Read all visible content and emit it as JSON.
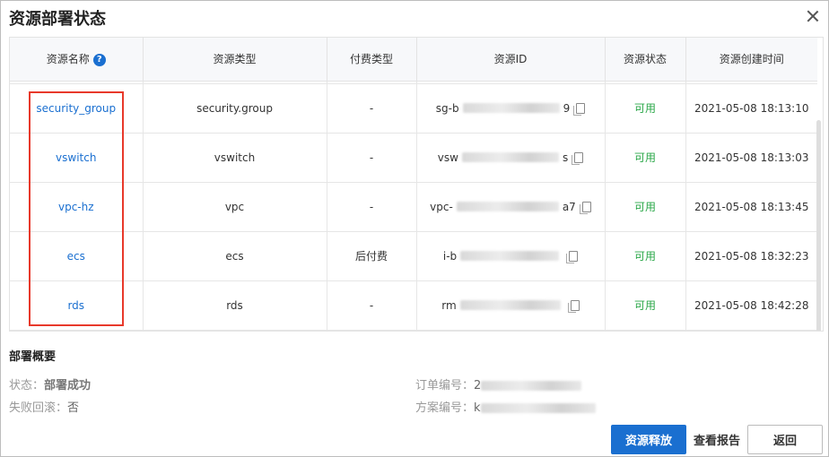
{
  "dialog": {
    "title": "资源部署状态"
  },
  "table": {
    "headers": [
      "资源名称",
      "资源类型",
      "付费类型",
      "资源ID",
      "资源状态",
      "资源创建时间"
    ],
    "rows": [
      {
        "name": "security_group",
        "type": "security.group",
        "pay": "-",
        "id_prefix": "sg-b",
        "id_suffix": "9",
        "status": "可用",
        "time": "2021-05-08 18:13:10"
      },
      {
        "name": "vswitch",
        "type": "vswitch",
        "pay": "-",
        "id_prefix": "vsw",
        "id_suffix": "s",
        "status": "可用",
        "time": "2021-05-08 18:13:03"
      },
      {
        "name": "vpc-hz",
        "type": "vpc",
        "pay": "-",
        "id_prefix": "vpc-",
        "id_suffix": "a7",
        "status": "可用",
        "time": "2021-05-08 18:13:45"
      },
      {
        "name": "ecs",
        "type": "ecs",
        "pay": "后付费",
        "id_prefix": "i-b",
        "id_suffix": "",
        "status": "可用",
        "time": "2021-05-08 18:32:23"
      },
      {
        "name": "rds",
        "type": "rds",
        "pay": "-",
        "id_prefix": "rm",
        "id_suffix": "",
        "status": "可用",
        "time": "2021-05-08 18:42:28"
      }
    ]
  },
  "summary": {
    "title": "部署概要",
    "status_label": "状态：",
    "status_value": "部署成功",
    "rollback_label": "失败回滚：",
    "rollback_value": "否",
    "order_label": "订单编号：",
    "order_value_prefix": "2",
    "plan_label": "方案编号：",
    "plan_value_prefix": "k"
  },
  "buttons": {
    "release": "资源释放",
    "report": "查看报告",
    "back": "返回"
  },
  "icons": {
    "help": "question-circle-icon",
    "close": "close-icon",
    "copy": "copy-icon"
  },
  "colors": {
    "accent": "#1a6fd0",
    "success": "#2aa748",
    "highlight": "#e8392b"
  }
}
